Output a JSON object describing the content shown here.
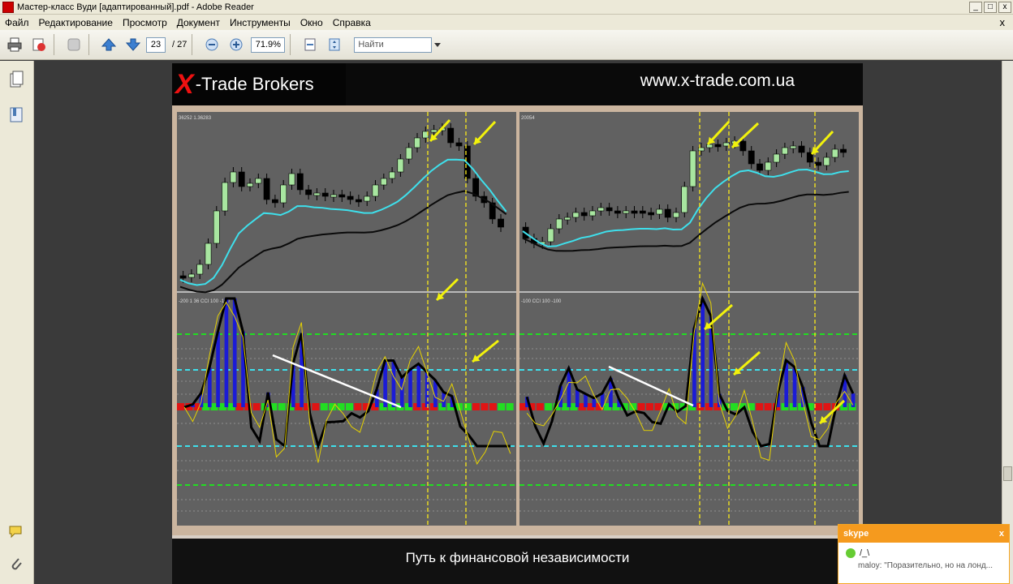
{
  "window": {
    "title": "Мастер-класс Вуди [адаптированный].pdf - Adobe Reader",
    "buttons": [
      "_",
      "□",
      "x"
    ]
  },
  "menu": {
    "items": [
      "Файл",
      "Редактирование",
      "Просмотр",
      "Документ",
      "Инструменты",
      "Окно",
      "Справка"
    ],
    "doc_close": "x"
  },
  "toolbar": {
    "current_page": "23",
    "total_pages": "/ 27",
    "zoom": "71.9%",
    "search_placeholder": "Найти"
  },
  "page": {
    "brand_x": "X",
    "brand_text": "-Trade Brokers",
    "site_url": "www.x-trade.com.ua",
    "left_price_label": "36252 1.36283",
    "right_price_label": "20054",
    "left_cci_label": "-200 1 36  CCI 100 -100",
    "right_cci_label": "-100  CCI 100 -100",
    "footer_text": "Путь к финансовой независимости"
  },
  "skype": {
    "app": "skype",
    "close": "x",
    "user": "/_\\",
    "message": "maloy: \"Поразительно, но на лонд..."
  },
  "colors": {
    "chart_bg": "#616161",
    "bull_candle": "#a8e6a0",
    "bear_candle": "#000000",
    "ema_fast": "#3ee0ec",
    "ema_slow": "#0a0a0a",
    "histogram": "#1b1bd6",
    "arrow": "#f2f20c",
    "zero_red": "#e01414",
    "zero_green": "#22dd22"
  }
}
